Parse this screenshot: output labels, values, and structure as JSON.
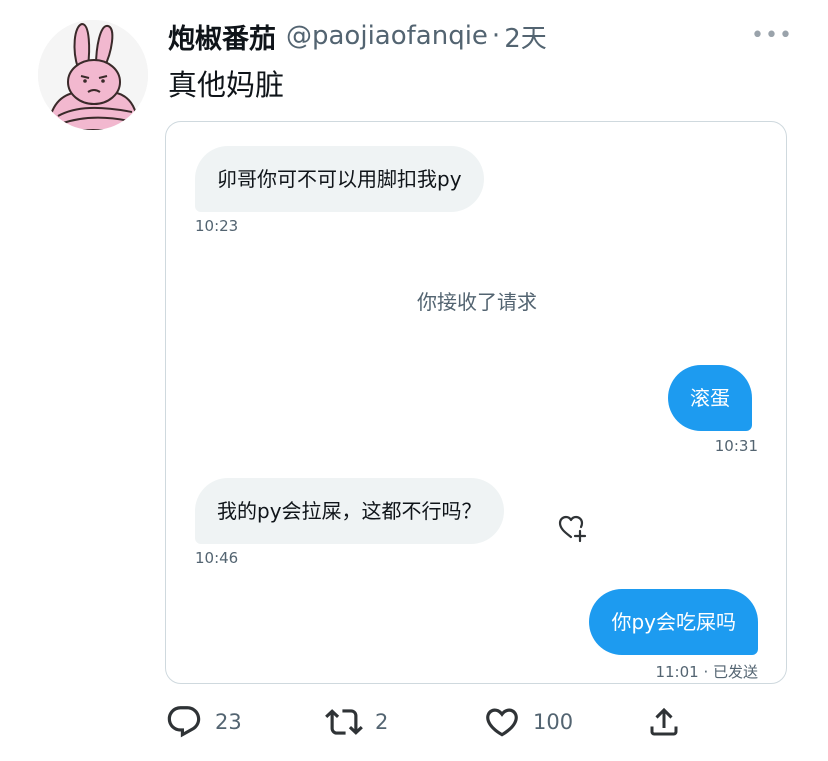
{
  "tweet": {
    "display_name": "炮椒番茄",
    "handle": "@paojiaofanqie",
    "separator": "·",
    "time": "2天",
    "text": "真他妈脏",
    "more_label": "•••"
  },
  "chat": {
    "messages": [
      {
        "text": "卯哥你可不可以用脚扣我py",
        "time": "10:23"
      },
      {
        "text": "你接收了请求"
      },
      {
        "text": "滚蛋",
        "time": "10:31"
      },
      {
        "text": "我的py会拉屎，这都不行吗？",
        "time": "10:46"
      },
      {
        "text": "你py会吃屎吗",
        "time": "11:01 · 已发送"
      }
    ],
    "react_icon": "heart-add-icon"
  },
  "actions": {
    "reply": {
      "icon": "reply-icon",
      "count": "23"
    },
    "retweet": {
      "icon": "retweet-icon",
      "count": "2"
    },
    "like": {
      "icon": "heart-icon",
      "count": "100"
    },
    "share": {
      "icon": "share-icon"
    }
  },
  "colors": {
    "accent": "#1d9bf0",
    "bubble_in": "#eff3f4",
    "muted_text": "#536471",
    "avatar_pink": "#f2b8cf"
  }
}
